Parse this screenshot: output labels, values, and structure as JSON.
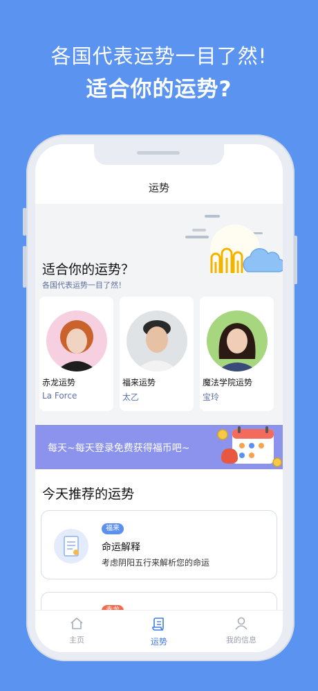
{
  "promo": {
    "line1": "各国代表运势一目了然!",
    "line2": "适合你的运势?"
  },
  "nav": {
    "title": "运势"
  },
  "hero": {
    "title": "适合你的运势？",
    "subtitle": "各国代表运势一目了然！"
  },
  "cards": [
    {
      "title": "赤龙运势",
      "author": "La Force"
    },
    {
      "title": "福来运势",
      "author": "太乙"
    },
    {
      "title": "魔法学院运势",
      "author": "宝玲"
    }
  ],
  "banner": {
    "text": "每天~每天登录免费获得福币吧~"
  },
  "recommend": {
    "section_title": "今天推荐的运势",
    "items": [
      {
        "tag": "福来",
        "title": "命运解释",
        "desc": "考虑阴阳五行来解析您的命运"
      },
      {
        "tag": "赤龙",
        "title": "",
        "desc": ""
      }
    ]
  },
  "tabs": [
    {
      "label": "主页",
      "icon": "home-icon"
    },
    {
      "label": "运势",
      "icon": "scroll-icon"
    },
    {
      "label": "我的信息",
      "icon": "user-icon"
    }
  ],
  "colors": {
    "background": "#5b93f0",
    "accent": "#3f7ae6",
    "banner": "#8b93ec"
  }
}
